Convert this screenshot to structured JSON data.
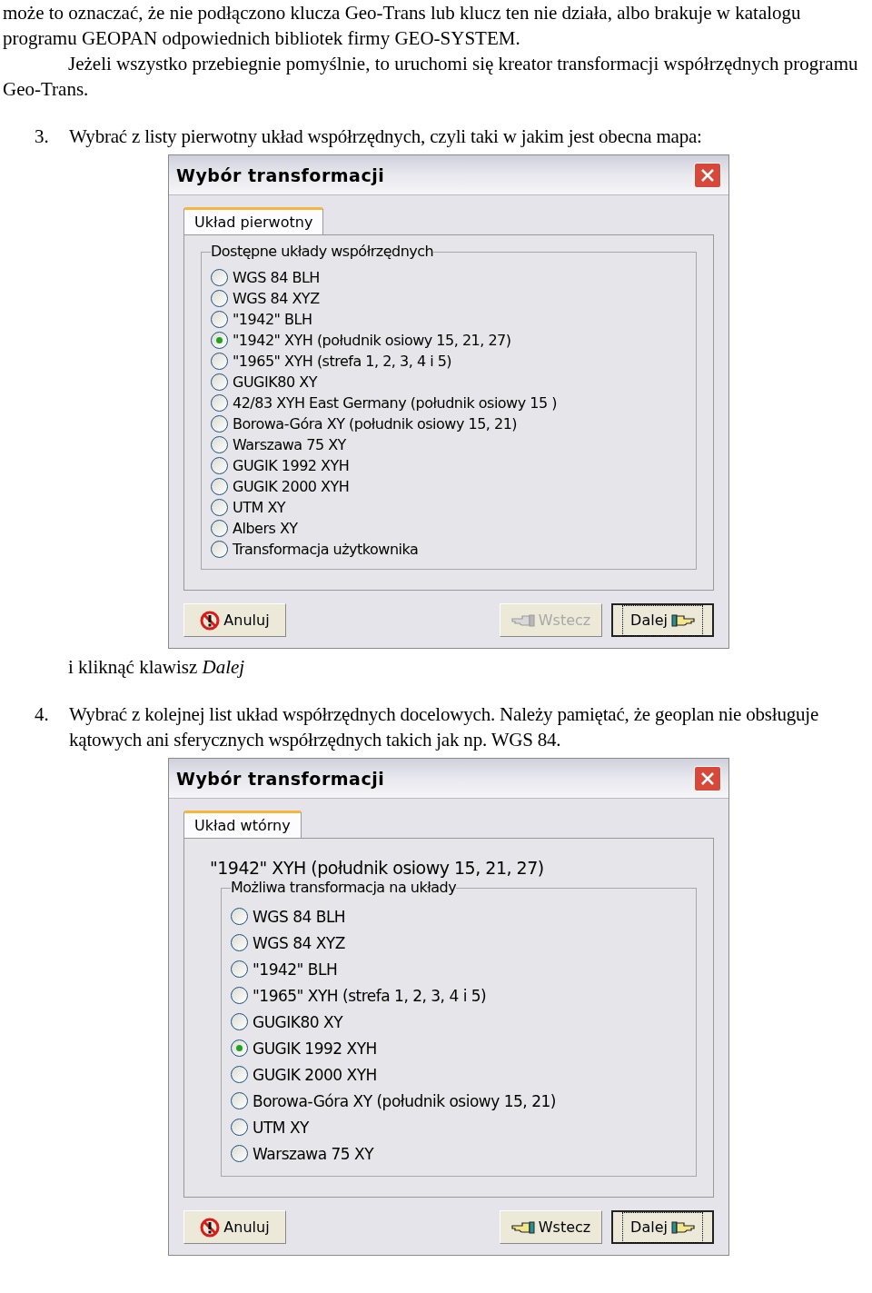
{
  "blocks": [
    {
      "kind": "paragraph",
      "text": "może to oznaczać, że nie podłączono klucza Geo-Trans lub klucz ten nie działa, albo brakuje w katalogu programu GEOPAN odpowiednich bibliotek firmy GEO-SYSTEM."
    },
    {
      "kind": "indented",
      "text": "Jeżeli wszystko przebiegnie pomyślnie, to uruchomi się kreator transformacji współrzędnych programu Geo-Trans."
    },
    {
      "kind": "step",
      "number": "3.",
      "text": "Wybrać z listy pierwotny układ współrzędnych, czyli taki w jakim jest obecna mapa:"
    },
    {
      "kind": "dialog",
      "title": "Wybór transformacji",
      "tab": {
        "label": "Układ pierwotny",
        "selected": true
      },
      "group_title": "Dostępne układy współrzędnych",
      "options": [
        {
          "label": "WGS 84 BLH",
          "selected": false
        },
        {
          "label": "WGS 84 XYZ",
          "selected": false
        },
        {
          "label": "\"1942\" BLH",
          "selected": false
        },
        {
          "label": "\"1942\" XYH (południk osiowy 15, 21, 27)",
          "selected": true
        },
        {
          "label": "\"1965\" XYH (strefa 1, 2, 3, 4 i 5)",
          "selected": false
        },
        {
          "label": "GUGIK80 XY",
          "selected": false
        },
        {
          "label": "42/83 XYH East Germany (południk osiowy 15 )",
          "selected": false
        },
        {
          "label": "Borowa-Góra XY (południk osiowy 15, 21)",
          "selected": false
        },
        {
          "label": "Warszawa 75 XY",
          "selected": false
        },
        {
          "label": "GUGIK 1992 XYH",
          "selected": false
        },
        {
          "label": "GUGIK 2000 XYH",
          "selected": false
        },
        {
          "label": "UTM XY",
          "selected": false
        },
        {
          "label": "Albers XY",
          "selected": false
        },
        {
          "label": "Transformacja użytkownika",
          "selected": false
        }
      ],
      "buttons": [
        {
          "kind": "cancel",
          "label": "Anuluj",
          "disabled": false,
          "focused": false
        },
        {
          "kind": "back",
          "label": "Wstecz",
          "disabled": true,
          "focused": false
        },
        {
          "kind": "next",
          "label": "Dalej",
          "disabled": false,
          "focused": true
        }
      ]
    },
    {
      "kind": "indented",
      "text": "i kliknąć klawisz *Dalej*"
    },
    {
      "kind": "step",
      "number": "4.",
      "text": "Wybrać z kolejnej list układ współrzędnych docelowych. Należy pamiętać, że geoplan nie obsługuje kątowych ani sferycznych współrzędnych takich jak np. WGS 84."
    },
    {
      "kind": "dialog",
      "title": "Wybór transformacji",
      "tab": {
        "label": "Układ wtórny",
        "selected": true
      },
      "header": "\"1942\" XYH (południk osiowy 15, 21, 27)",
      "group_title": "Możliwa transformacja na układy",
      "options": [
        {
          "label": "WGS 84 BLH",
          "selected": false
        },
        {
          "label": "WGS 84 XYZ",
          "selected": false
        },
        {
          "label": "\"1942\" BLH",
          "selected": false
        },
        {
          "label": "\"1965\" XYH (strefa 1, 2, 3, 4 i 5)",
          "selected": false
        },
        {
          "label": "GUGIK80 XY",
          "selected": false
        },
        {
          "label": "GUGIK 1992 XYH",
          "selected": true
        },
        {
          "label": "GUGIK 2000 XYH",
          "selected": false
        },
        {
          "label": "Borowa-Góra XY (południk osiowy 15, 21)",
          "selected": false
        },
        {
          "label": "UTM XY",
          "selected": false
        },
        {
          "label": "Warszawa 75 XY",
          "selected": false
        }
      ],
      "buttons": [
        {
          "kind": "cancel",
          "label": "Anuluj",
          "disabled": false,
          "focused": false
        },
        {
          "kind": "back",
          "label": "Wstecz",
          "disabled": false,
          "focused": false
        },
        {
          "kind": "next",
          "label": "Dalej",
          "disabled": false,
          "focused": true
        }
      ]
    }
  ]
}
